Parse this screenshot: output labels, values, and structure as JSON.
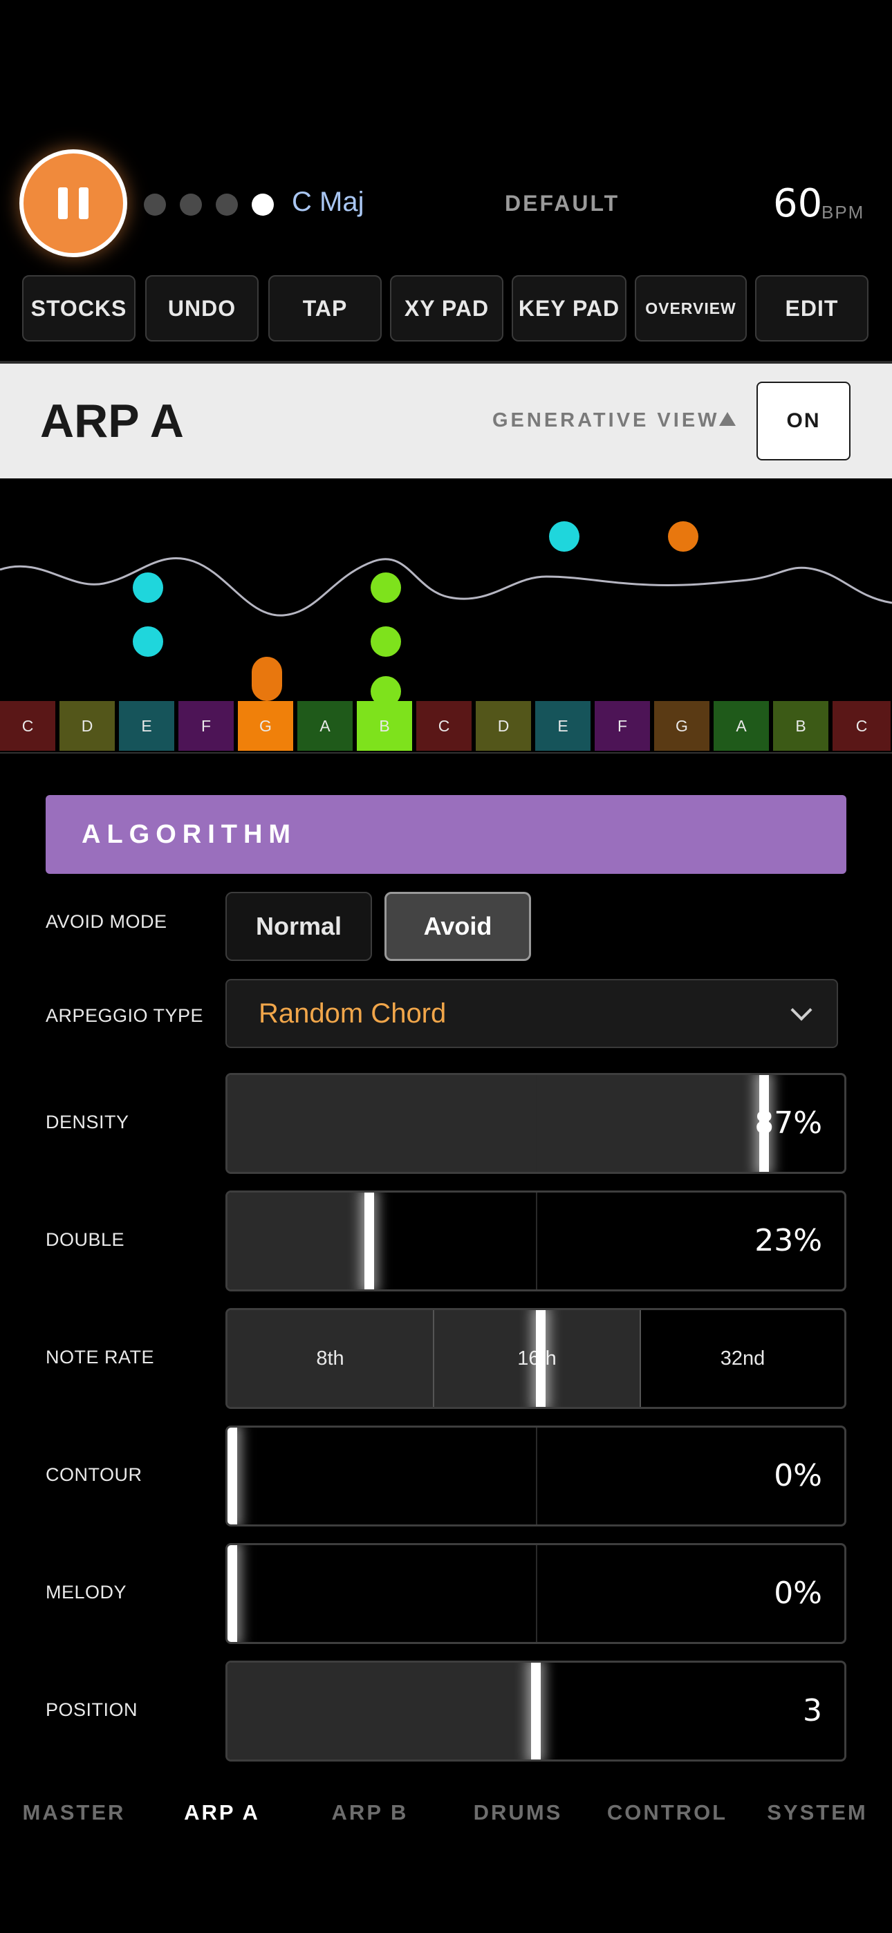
{
  "transport": {
    "play_state_icon": "pause-icon",
    "pattern_dots": [
      false,
      false,
      false,
      true
    ],
    "key": "C Maj",
    "preset": "DEFAULT",
    "bpm": "60",
    "bpm_unit": "BPM"
  },
  "toolbar": {
    "stocks": "STOCKS",
    "undo": "UNDO",
    "tap": "TAP",
    "xy_pad": "XY PAD",
    "key_pad": "KEY PAD",
    "overview": "OVERVIEW",
    "edit": "EDIT"
  },
  "header": {
    "title": "ARP A",
    "generative_view": "GENERATIVE VIEW",
    "toggle": "ON"
  },
  "keyboard": {
    "keys": [
      {
        "note": "C",
        "color": "#5a1717"
      },
      {
        "note": "D",
        "color": "#53561a"
      },
      {
        "note": "E",
        "color": "#16545a"
      },
      {
        "note": "F",
        "color": "#4d1456"
      },
      {
        "note": "G",
        "color": "#f0800a"
      },
      {
        "note": "A",
        "color": "#1f5a1a"
      },
      {
        "note": "B",
        "color": "#7ee21c"
      },
      {
        "note": "C",
        "color": "#5a1717"
      },
      {
        "note": "D",
        "color": "#53561a"
      },
      {
        "note": "E",
        "color": "#16545a"
      },
      {
        "note": "F",
        "color": "#4d1456"
      },
      {
        "note": "G",
        "color": "#5a3a14"
      },
      {
        "note": "A",
        "color": "#1f5a1a"
      },
      {
        "note": "B",
        "color": "#3c5a16"
      },
      {
        "note": "C",
        "color": "#5a1717"
      }
    ]
  },
  "algorithm": {
    "title": "ALGORITHM",
    "avoid_mode": {
      "label": "AVOID MODE",
      "options": [
        "Normal",
        "Avoid"
      ],
      "selected": "Avoid"
    },
    "arpeggio_type": {
      "label": "ARPEGGIO TYPE",
      "value": "Random Chord"
    },
    "density": {
      "label": "DENSITY",
      "value": "87%",
      "fraction": 0.87
    },
    "double": {
      "label": "DOUBLE",
      "value": "23%",
      "fraction": 0.23
    },
    "note_rate": {
      "label": "NOTE RATE",
      "options": [
        "8th",
        "16th",
        "32nd"
      ],
      "selected": "16th"
    },
    "contour": {
      "label": "CONTOUR",
      "value": "0%",
      "fraction": 0
    },
    "melody": {
      "label": "MELODY",
      "value": "0%",
      "fraction": 0
    },
    "position": {
      "label": "POSITION",
      "value": "3",
      "fraction": 0.5
    }
  },
  "nav": {
    "items": [
      "MASTER",
      "ARP A",
      "ARP B",
      "DRUMS",
      "CONTROL",
      "SYSTEM"
    ],
    "active": "ARP A"
  },
  "colors": {
    "accent_orange": "#f08a3c",
    "algorithm_purple": "#9a6fbd",
    "note_cyan": "#1fd6dc",
    "note_green": "#7ee21c",
    "note_orange": "#e8770e"
  }
}
